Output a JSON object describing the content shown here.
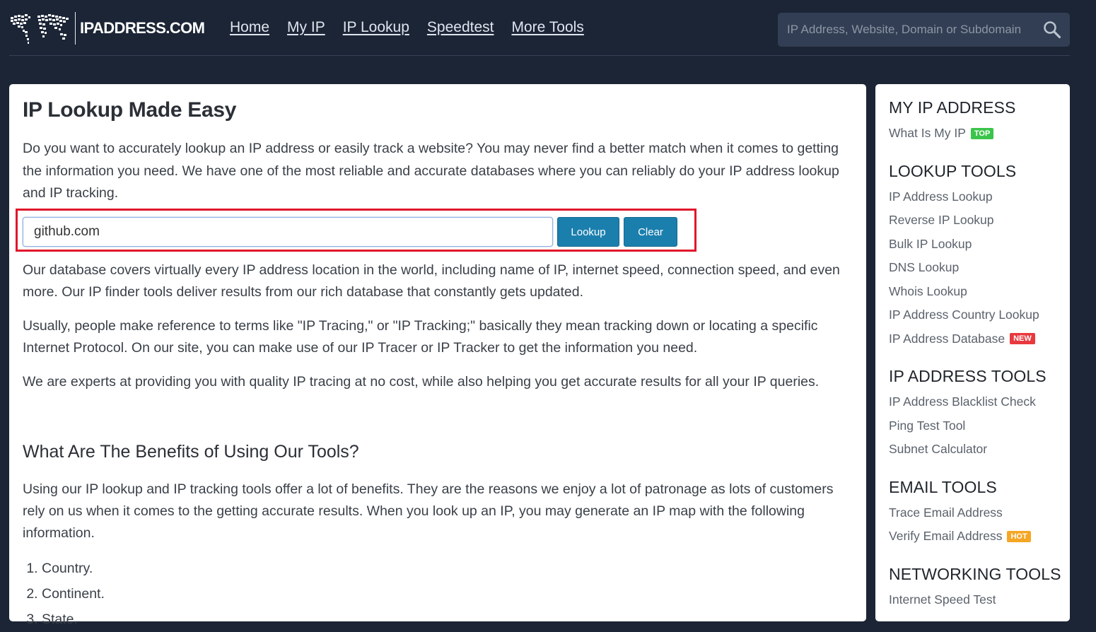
{
  "site": {
    "logo_text": "IPADDRESS.COM",
    "nav": [
      "Home",
      "My IP",
      "IP Lookup",
      "Speedtest",
      "More Tools"
    ],
    "search_placeholder": "IP Address, Website, Domain or Subdomain",
    "search_icon": "magnifier-icon"
  },
  "main": {
    "title": "IP Lookup Made Easy",
    "intro": "Do you want to accurately lookup an IP address or easily track a website? You may never find a better match when it comes to getting the information you need. We have one of the most reliable and accurate databases where you can reliably do your IP address lookup and IP tracking.",
    "lookup": {
      "value": "github.com",
      "lookup_label": "Lookup",
      "clear_label": "Clear"
    },
    "para1": "Our database covers virtually every IP address location in the world, including name of IP, internet speed, connection speed, and even more. Our IP finder tools deliver results from our rich database that constantly gets updated.",
    "para2": "Usually, people make reference to terms like \"IP Tracing,\" or \"IP Tracking;\" basically they mean tracking down or locating a specific Internet Protocol. On our site, you can make use of our IP Tracer or IP Tracker to get the information you need.",
    "para3": "We are experts at providing you with quality IP tracing at no cost, while also helping you get accurate results for all your IP queries.",
    "benefits_heading": "What Are The Benefits of Using Our Tools?",
    "para4": "Using our IP lookup and IP tracking tools offer a lot of benefits. They are the reasons we enjoy a lot of patronage as lots of customers rely on us when it comes to the getting accurate results. When you look up an IP, you may generate an IP map with the following information.",
    "benefits": [
      "Country.",
      "Continent.",
      "State."
    ]
  },
  "sidebar": {
    "sections": [
      {
        "title": "MY IP ADDRESS",
        "links": [
          {
            "label": "What Is My IP",
            "badge": "TOP",
            "badge_color": "#3bc44b"
          }
        ]
      },
      {
        "title": "LOOKUP TOOLS",
        "links": [
          {
            "label": "IP Address Lookup"
          },
          {
            "label": "Reverse IP Lookup"
          },
          {
            "label": "Bulk IP Lookup"
          },
          {
            "label": "DNS Lookup"
          },
          {
            "label": "Whois Lookup"
          },
          {
            "label": "IP Address Country Lookup"
          },
          {
            "label": "IP Address Database",
            "badge": "NEW",
            "badge_color": "#e8393f"
          }
        ]
      },
      {
        "title": "IP ADDRESS TOOLS",
        "links": [
          {
            "label": "IP Address Blacklist Check"
          },
          {
            "label": "Ping Test Tool"
          },
          {
            "label": "Subnet Calculator"
          }
        ]
      },
      {
        "title": "EMAIL TOOLS",
        "links": [
          {
            "label": "Trace Email Address"
          },
          {
            "label": "Verify Email Address",
            "badge": "HOT",
            "badge_color": "#f5a623"
          }
        ]
      },
      {
        "title": "NETWORKING TOOLS",
        "links": [
          {
            "label": "Internet Speed Test"
          }
        ]
      }
    ]
  }
}
